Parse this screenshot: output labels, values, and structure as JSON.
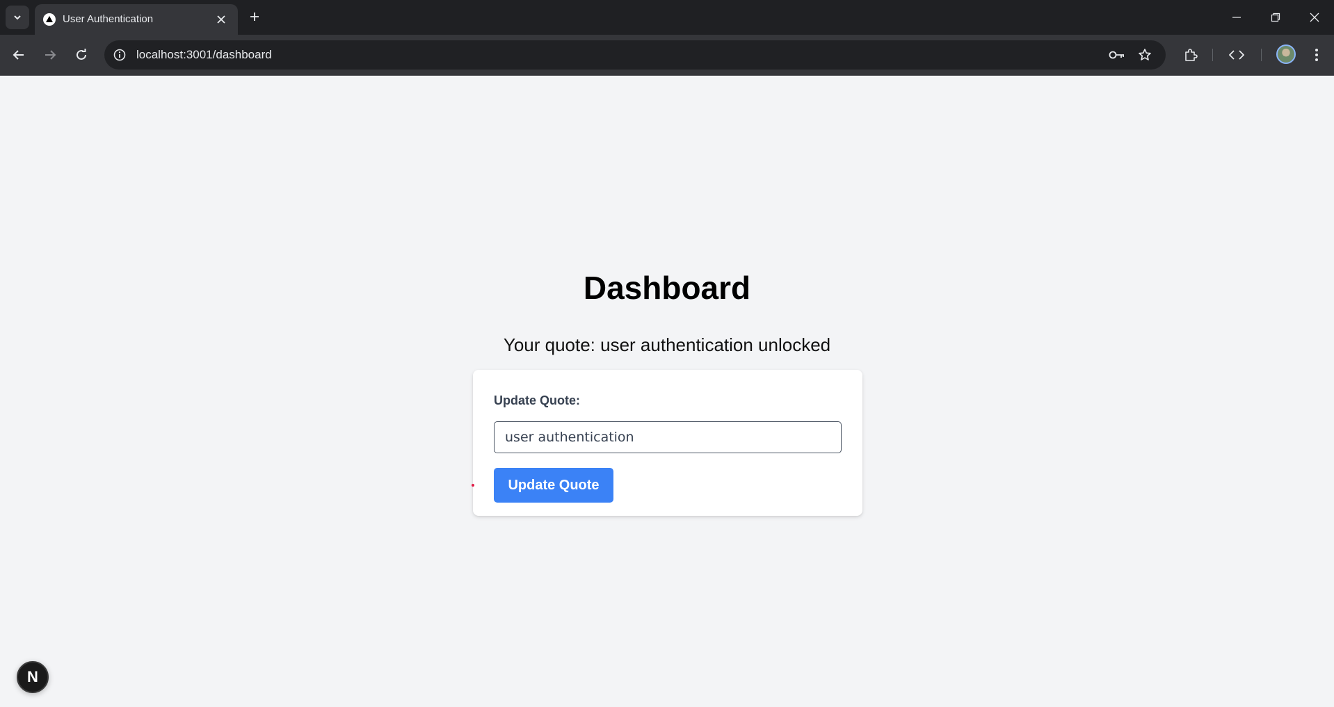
{
  "browser": {
    "tab_title": "User Authentication",
    "url": "localhost:3001/dashboard"
  },
  "page": {
    "title": "Dashboard",
    "quote_text": "Your quote: user authentication unlocked",
    "form": {
      "label": "Update Quote:",
      "input_value": "user authentication",
      "button_label": "Update Quote"
    },
    "dev_badge_letter": "N"
  },
  "colors": {
    "accent_button": "#3b82f6",
    "page_background": "#f3f4f6",
    "chrome_dark": "#1f2023"
  },
  "icons": {
    "tab_search": "chevron-down-icon",
    "tab_favicon": "triangle-icon",
    "tab_close": "close-icon",
    "new_tab": "plus-icon",
    "back": "arrow-left-icon",
    "forward": "arrow-right-icon",
    "reload": "reload-icon",
    "site_info": "info-icon",
    "passwords": "key-icon",
    "bookmark": "star-icon",
    "extensions": "puzzle-icon",
    "devtools": "code-icon",
    "menu": "kebab-menu-icon"
  }
}
